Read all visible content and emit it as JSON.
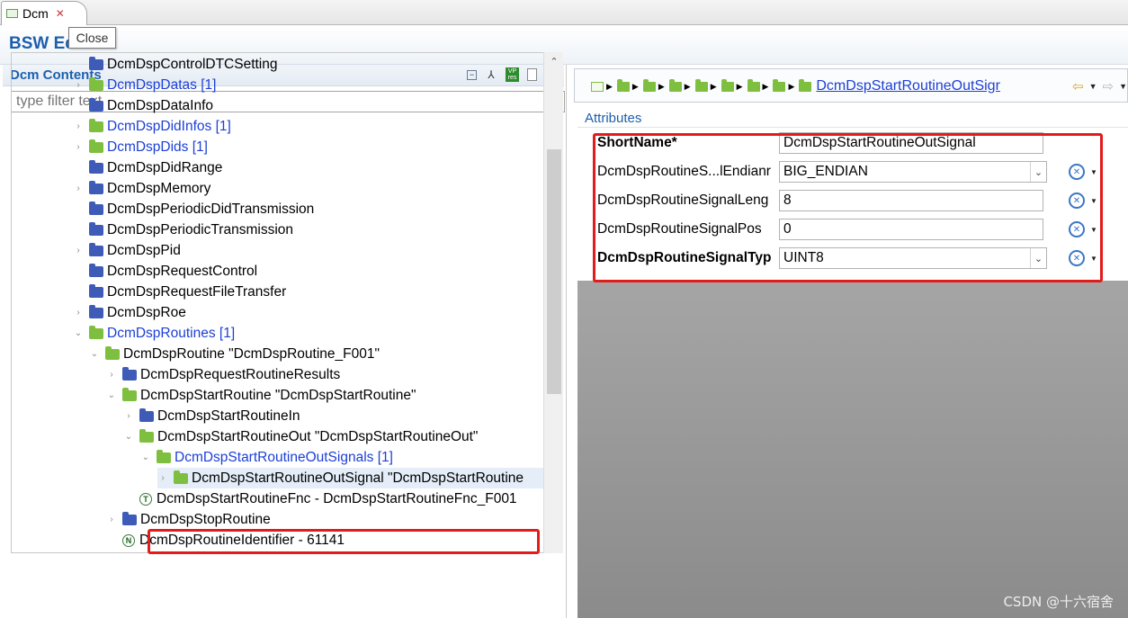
{
  "tab": {
    "label": "Dcm",
    "close_glyph": "✕"
  },
  "editor": {
    "title": "BSW Editor"
  },
  "tooltip": {
    "text": "Close"
  },
  "left": {
    "title": "Dcm Contents",
    "filter_placeholder": "type filter text",
    "tool_vp_line1": "VP",
    "tool_vp_line2": "res"
  },
  "tree": [
    {
      "label": "DcmDspControlDTCSetting",
      "folder": "blue",
      "link": false,
      "twisty": ""
    },
    {
      "label": "DcmDspDatas [1]",
      "folder": "green",
      "link": true,
      "twisty": "›"
    },
    {
      "label": "DcmDspDataInfo",
      "folder": "blue",
      "link": false,
      "twisty": ""
    },
    {
      "label": "DcmDspDidInfos [1]",
      "folder": "green",
      "link": true,
      "twisty": "›"
    },
    {
      "label": "DcmDspDids [1]",
      "folder": "green",
      "link": true,
      "twisty": "›"
    },
    {
      "label": "DcmDspDidRange",
      "folder": "blue",
      "link": false,
      "twisty": ""
    },
    {
      "label": "DcmDspMemory",
      "folder": "blue",
      "link": false,
      "twisty": "›"
    },
    {
      "label": "DcmDspPeriodicDidTransmission",
      "folder": "blue",
      "link": false,
      "twisty": ""
    },
    {
      "label": "DcmDspPeriodicTransmission",
      "folder": "blue",
      "link": false,
      "twisty": ""
    },
    {
      "label": "DcmDspPid",
      "folder": "blue",
      "link": false,
      "twisty": "›"
    },
    {
      "label": "DcmDspRequestControl",
      "folder": "blue",
      "link": false,
      "twisty": ""
    },
    {
      "label": "DcmDspRequestFileTransfer",
      "folder": "blue",
      "link": false,
      "twisty": ""
    },
    {
      "label": "DcmDspRoe",
      "folder": "blue",
      "link": false,
      "twisty": "›"
    },
    {
      "label": "DcmDspRoutines [1]",
      "folder": "green",
      "link": true,
      "twisty": "⌄"
    },
    {
      "label": "DcmDspRoutine \"DcmDspRoutine_F001\"",
      "folder": "green",
      "link": false,
      "twisty": "⌄"
    },
    {
      "label": "DcmDspRequestRoutineResults",
      "folder": "blue",
      "link": false,
      "twisty": "›"
    },
    {
      "label": "DcmDspStartRoutine \"DcmDspStartRoutine\"",
      "folder": "green",
      "link": false,
      "twisty": "⌄"
    },
    {
      "label": "DcmDspStartRoutineIn",
      "folder": "blue",
      "link": false,
      "twisty": "›"
    },
    {
      "label": "DcmDspStartRoutineOut \"DcmDspStartRoutineOut\"",
      "folder": "green",
      "link": false,
      "twisty": "⌄"
    },
    {
      "label": "DcmDspStartRoutineOutSignals [1]",
      "folder": "green",
      "link": true,
      "twisty": "⌄"
    },
    {
      "label": "DcmDspStartRoutineOutSignal \"DcmDspStartRoutine",
      "folder": "green",
      "link": false,
      "twisty": "›",
      "selected": true
    },
    {
      "label": "DcmDspStartRoutineFnc - DcmDspStartRoutineFnc_F001",
      "folder": "T",
      "link": false,
      "twisty": ""
    },
    {
      "label": "DcmDspStopRoutine",
      "folder": "blue",
      "link": false,
      "twisty": "›"
    },
    {
      "label": "DcmDspRoutineIdentifier - 61141",
      "folder": "N",
      "link": false,
      "twisty": ""
    }
  ],
  "breadcrumb": {
    "current": "DcmDspStartRoutineOutSigr"
  },
  "attributes": {
    "title": "Attributes",
    "rows": [
      {
        "label": "ShortName*",
        "value": "DcmDspStartRoutineOutSignal",
        "kind": "text",
        "bold": true,
        "reset": false
      },
      {
        "label": "DcmDspRoutineS...lEndianr",
        "value": "BIG_ENDIAN",
        "kind": "select",
        "bold": false,
        "reset": true
      },
      {
        "label": "DcmDspRoutineSignalLeng",
        "value": "8",
        "kind": "text",
        "bold": false,
        "reset": true
      },
      {
        "label": "DcmDspRoutineSignalPos",
        "value": "0",
        "kind": "text",
        "bold": false,
        "reset": true
      },
      {
        "label": "DcmDspRoutineSignalTyp",
        "value": "UINT8",
        "kind": "select",
        "bold": true,
        "reset": true
      }
    ]
  },
  "watermark": "CSDN @十六宿舍",
  "colors": {
    "accent": "#1d5fad",
    "link": "#1c3fd6",
    "highlight": "#e21b1b",
    "folder_blue": "#3e5bb7",
    "folder_green": "#7fbf3f"
  }
}
